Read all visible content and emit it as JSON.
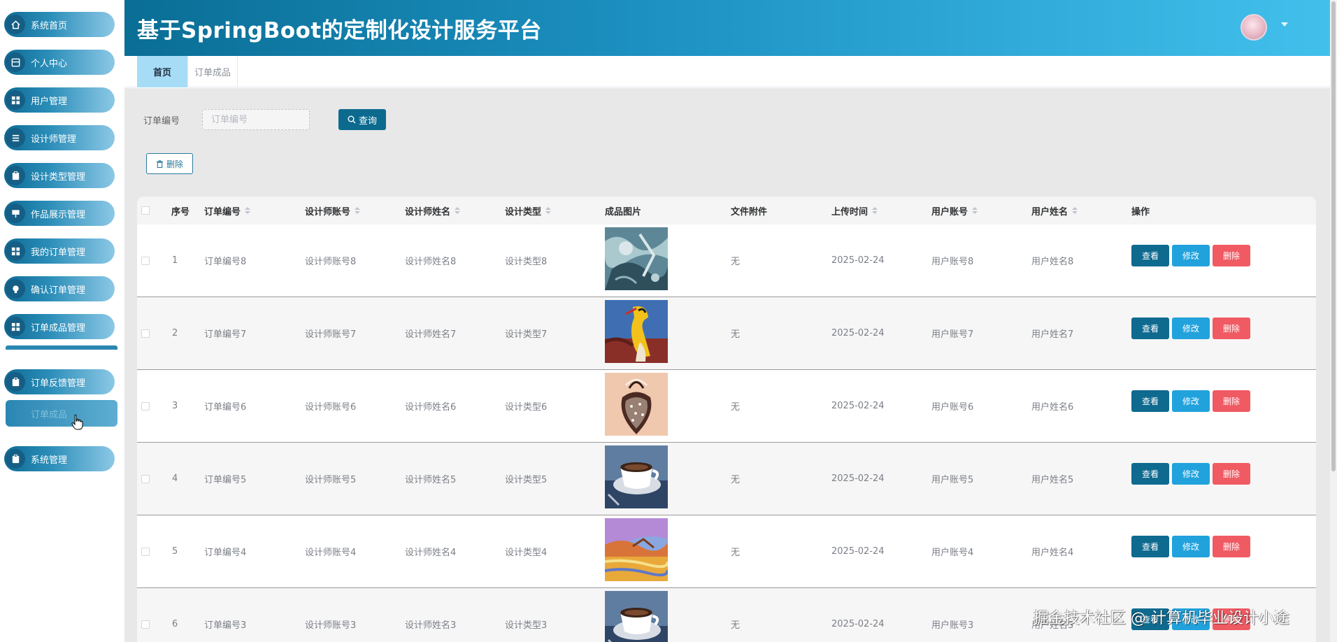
{
  "header": {
    "title": "基于SpringBoot的定制化设计服务平台"
  },
  "sidebar": {
    "items": [
      {
        "label": "系统首页",
        "icon": "home-icon"
      },
      {
        "label": "个人中心",
        "icon": "profile-icon"
      },
      {
        "label": "用户管理",
        "icon": "grid-icon"
      },
      {
        "label": "设计师管理",
        "icon": "list-icon"
      },
      {
        "label": "设计类型管理",
        "icon": "clipboard-icon"
      },
      {
        "label": "作品展示管理",
        "icon": "board-icon"
      },
      {
        "label": "我的订单管理",
        "icon": "grid-icon"
      },
      {
        "label": "确认订单管理",
        "icon": "bulb-icon"
      },
      {
        "label": "订单成品管理",
        "icon": "grid-icon"
      },
      {
        "label": "订单反馈管理",
        "icon": "clipboard-icon"
      },
      {
        "label": "系统管理",
        "icon": "clipboard-icon"
      }
    ],
    "active_sub_label": "订单成品"
  },
  "tabs": [
    {
      "label": "首页",
      "active": true
    },
    {
      "label": "订单成品",
      "active": false
    }
  ],
  "search": {
    "label": "订单编号",
    "placeholder": "订单编号",
    "value": "",
    "query_button": "查询",
    "delete_button": "删除"
  },
  "table": {
    "headers": {
      "index": "序号",
      "order_no": "订单编号",
      "designer_account": "设计师账号",
      "designer_name": "设计师姓名",
      "design_type": "设计类型",
      "product_image": "成品图片",
      "attachment": "文件附件",
      "upload_time": "上传时间",
      "user_account": "用户账号",
      "user_name": "用户姓名",
      "actions": "操作"
    },
    "action_labels": {
      "view": "查看",
      "edit": "修改",
      "delete": "删除"
    },
    "rows": [
      {
        "index": "1",
        "order_no": "订单编号8",
        "designer_account": "设计师账号8",
        "designer_name": "设计师姓名8",
        "design_type": "设计类型8",
        "image": "abstract-blue-painting",
        "attachment": "无",
        "upload_time": "2025-02-24",
        "user_account": "用户账号8",
        "user_name": "用户姓名8"
      },
      {
        "index": "2",
        "order_no": "订单编号7",
        "designer_account": "设计师账号7",
        "designer_name": "设计师姓名7",
        "design_type": "设计类型7",
        "image": "surreal-figure-painting",
        "attachment": "无",
        "upload_time": "2025-02-24",
        "user_account": "用户账号7",
        "user_name": "用户姓名7"
      },
      {
        "index": "3",
        "order_no": "订单编号6",
        "designer_account": "设计师账号6",
        "designer_name": "设计师姓名6",
        "design_type": "设计类型6",
        "image": "strawberry-sketch",
        "attachment": "无",
        "upload_time": "2025-02-24",
        "user_account": "用户账号6",
        "user_name": "用户姓名6"
      },
      {
        "index": "4",
        "order_no": "订单编号5",
        "designer_account": "设计师账号5",
        "designer_name": "设计师姓名5",
        "design_type": "设计类型5",
        "image": "coffee-cup-photo",
        "attachment": "无",
        "upload_time": "2025-02-24",
        "user_account": "用户账号5",
        "user_name": "用户姓名5"
      },
      {
        "index": "5",
        "order_no": "订单编号4",
        "designer_account": "设计师账号4",
        "designer_name": "设计师姓名4",
        "design_type": "设计类型4",
        "image": "colorful-landscape-painting",
        "attachment": "无",
        "upload_time": "2025-02-24",
        "user_account": "用户账号4",
        "user_name": "用户姓名4"
      },
      {
        "index": "6",
        "order_no": "订单编号3",
        "designer_account": "设计师账号3",
        "designer_name": "设计师姓名3",
        "design_type": "设计类型3",
        "image": "coffee-cup-photo",
        "attachment": "无",
        "upload_time": "2025-02-24",
        "user_account": "用户账号3",
        "user_name": "用户姓名3"
      }
    ]
  },
  "watermark": "掘金技术社区 @ 计算机毕业设计小途",
  "colors": {
    "primary": "#0d6a8f",
    "edit": "#21a2dc",
    "danger": "#f05a63",
    "tab_active": "#a7dcf6"
  }
}
